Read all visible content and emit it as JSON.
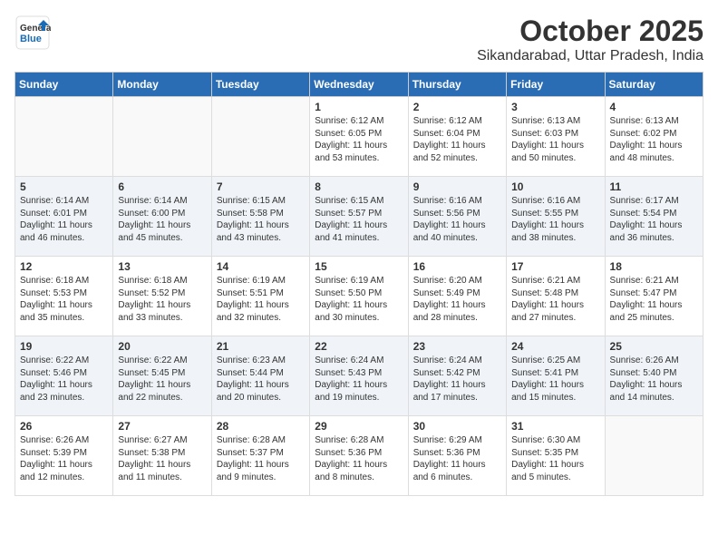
{
  "logo": {
    "general": "General",
    "blue": "Blue"
  },
  "title": "October 2025",
  "location": "Sikandarabad, Uttar Pradesh, India",
  "weekdays": [
    "Sunday",
    "Monday",
    "Tuesday",
    "Wednesday",
    "Thursday",
    "Friday",
    "Saturday"
  ],
  "weeks": [
    [
      {
        "day": "",
        "info": ""
      },
      {
        "day": "",
        "info": ""
      },
      {
        "day": "",
        "info": ""
      },
      {
        "day": "1",
        "info": "Sunrise: 6:12 AM\nSunset: 6:05 PM\nDaylight: 11 hours\nand 53 minutes."
      },
      {
        "day": "2",
        "info": "Sunrise: 6:12 AM\nSunset: 6:04 PM\nDaylight: 11 hours\nand 52 minutes."
      },
      {
        "day": "3",
        "info": "Sunrise: 6:13 AM\nSunset: 6:03 PM\nDaylight: 11 hours\nand 50 minutes."
      },
      {
        "day": "4",
        "info": "Sunrise: 6:13 AM\nSunset: 6:02 PM\nDaylight: 11 hours\nand 48 minutes."
      }
    ],
    [
      {
        "day": "5",
        "info": "Sunrise: 6:14 AM\nSunset: 6:01 PM\nDaylight: 11 hours\nand 46 minutes."
      },
      {
        "day": "6",
        "info": "Sunrise: 6:14 AM\nSunset: 6:00 PM\nDaylight: 11 hours\nand 45 minutes."
      },
      {
        "day": "7",
        "info": "Sunrise: 6:15 AM\nSunset: 5:58 PM\nDaylight: 11 hours\nand 43 minutes."
      },
      {
        "day": "8",
        "info": "Sunrise: 6:15 AM\nSunset: 5:57 PM\nDaylight: 11 hours\nand 41 minutes."
      },
      {
        "day": "9",
        "info": "Sunrise: 6:16 AM\nSunset: 5:56 PM\nDaylight: 11 hours\nand 40 minutes."
      },
      {
        "day": "10",
        "info": "Sunrise: 6:16 AM\nSunset: 5:55 PM\nDaylight: 11 hours\nand 38 minutes."
      },
      {
        "day": "11",
        "info": "Sunrise: 6:17 AM\nSunset: 5:54 PM\nDaylight: 11 hours\nand 36 minutes."
      }
    ],
    [
      {
        "day": "12",
        "info": "Sunrise: 6:18 AM\nSunset: 5:53 PM\nDaylight: 11 hours\nand 35 minutes."
      },
      {
        "day": "13",
        "info": "Sunrise: 6:18 AM\nSunset: 5:52 PM\nDaylight: 11 hours\nand 33 minutes."
      },
      {
        "day": "14",
        "info": "Sunrise: 6:19 AM\nSunset: 5:51 PM\nDaylight: 11 hours\nand 32 minutes."
      },
      {
        "day": "15",
        "info": "Sunrise: 6:19 AM\nSunset: 5:50 PM\nDaylight: 11 hours\nand 30 minutes."
      },
      {
        "day": "16",
        "info": "Sunrise: 6:20 AM\nSunset: 5:49 PM\nDaylight: 11 hours\nand 28 minutes."
      },
      {
        "day": "17",
        "info": "Sunrise: 6:21 AM\nSunset: 5:48 PM\nDaylight: 11 hours\nand 27 minutes."
      },
      {
        "day": "18",
        "info": "Sunrise: 6:21 AM\nSunset: 5:47 PM\nDaylight: 11 hours\nand 25 minutes."
      }
    ],
    [
      {
        "day": "19",
        "info": "Sunrise: 6:22 AM\nSunset: 5:46 PM\nDaylight: 11 hours\nand 23 minutes."
      },
      {
        "day": "20",
        "info": "Sunrise: 6:22 AM\nSunset: 5:45 PM\nDaylight: 11 hours\nand 22 minutes."
      },
      {
        "day": "21",
        "info": "Sunrise: 6:23 AM\nSunset: 5:44 PM\nDaylight: 11 hours\nand 20 minutes."
      },
      {
        "day": "22",
        "info": "Sunrise: 6:24 AM\nSunset: 5:43 PM\nDaylight: 11 hours\nand 19 minutes."
      },
      {
        "day": "23",
        "info": "Sunrise: 6:24 AM\nSunset: 5:42 PM\nDaylight: 11 hours\nand 17 minutes."
      },
      {
        "day": "24",
        "info": "Sunrise: 6:25 AM\nSunset: 5:41 PM\nDaylight: 11 hours\nand 15 minutes."
      },
      {
        "day": "25",
        "info": "Sunrise: 6:26 AM\nSunset: 5:40 PM\nDaylight: 11 hours\nand 14 minutes."
      }
    ],
    [
      {
        "day": "26",
        "info": "Sunrise: 6:26 AM\nSunset: 5:39 PM\nDaylight: 11 hours\nand 12 minutes."
      },
      {
        "day": "27",
        "info": "Sunrise: 6:27 AM\nSunset: 5:38 PM\nDaylight: 11 hours\nand 11 minutes."
      },
      {
        "day": "28",
        "info": "Sunrise: 6:28 AM\nSunset: 5:37 PM\nDaylight: 11 hours\nand 9 minutes."
      },
      {
        "day": "29",
        "info": "Sunrise: 6:28 AM\nSunset: 5:36 PM\nDaylight: 11 hours\nand 8 minutes."
      },
      {
        "day": "30",
        "info": "Sunrise: 6:29 AM\nSunset: 5:36 PM\nDaylight: 11 hours\nand 6 minutes."
      },
      {
        "day": "31",
        "info": "Sunrise: 6:30 AM\nSunset: 5:35 PM\nDaylight: 11 hours\nand 5 minutes."
      },
      {
        "day": "",
        "info": ""
      }
    ]
  ]
}
